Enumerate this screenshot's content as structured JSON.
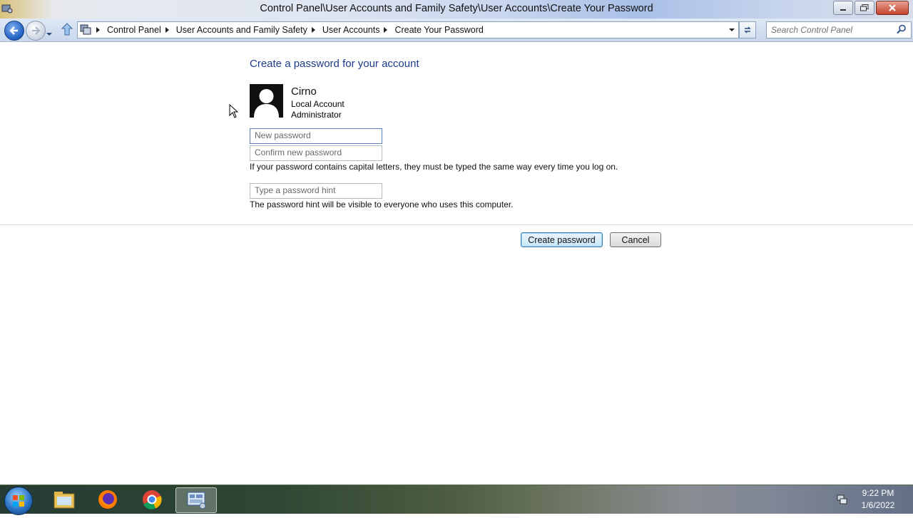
{
  "window": {
    "title": "Control Panel\\User Accounts and Family Safety\\User Accounts\\Create Your Password",
    "minimize_icon": "minimize-icon",
    "maximize_icon": "restore-icon",
    "close_icon": "close-icon"
  },
  "nav": {
    "breadcrumbs": [
      "Control Panel",
      "User Accounts and Family Safety",
      "User Accounts",
      "Create Your Password"
    ],
    "search_placeholder": "Search Control Panel"
  },
  "page": {
    "heading": "Create a password for your account",
    "user": {
      "name": "Cirno",
      "account_type": "Local Account",
      "role": "Administrator"
    },
    "new_password_placeholder": "New password",
    "confirm_password_placeholder": "Confirm new password",
    "caps_note": "If your password contains capital letters, they must be typed the same way every time you log on.",
    "hint_placeholder": "Type a password hint",
    "hint_note": "The password hint will be visible to everyone who uses this computer.",
    "create_button": "Create password",
    "cancel_button": "Cancel"
  },
  "taskbar": {
    "items": [
      "start-orb",
      "file-explorer-icon",
      "firefox-icon",
      "chrome-icon",
      "control-panel-icon"
    ],
    "active": "control-panel-icon",
    "time": "9:22 PM",
    "date": "1/6/2022"
  },
  "colors": {
    "heading": "#1e3a8a",
    "primary_button_border": "#3c7fb1"
  }
}
